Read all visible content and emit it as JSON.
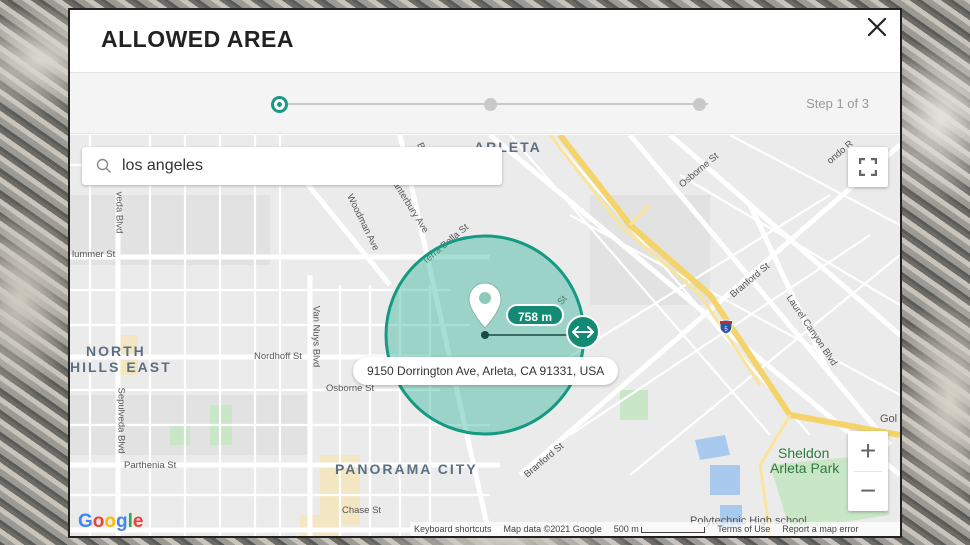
{
  "modal": {
    "title": "ALLOWED AREA",
    "close_icon": "close-icon"
  },
  "stepper": {
    "steps": 3,
    "current": 1,
    "label": "Step 1 of 3"
  },
  "search": {
    "value": "los angeles",
    "icon": "search-icon"
  },
  "map": {
    "area_labels": [
      "ARLETA",
      "NORTH",
      "HILLS EAST",
      "PANORAMA CITY",
      "Sheldon",
      "Arleta Park"
    ],
    "streets": [
      "Osborne St",
      "Woodman Ave",
      "Terra Bella St",
      "Van Nuys Blvd",
      "Nordhoff St",
      "Osborne St",
      "Parthenia St",
      "Branford St",
      "Laurel Canyon Blvd",
      "Branford St",
      "Chase St",
      "Sepulveda Blvd",
      "lummer St",
      "veda Blvd",
      "Canterbury Ave",
      "Be",
      "ondo R",
      "Gol",
      "Polytechnic High school",
      "St"
    ],
    "highway_shield": "5",
    "radius_label": "758 m",
    "address": "9150 Dorrington Ave, Arleta, CA 91331, USA",
    "google_logo": "Google",
    "attribution": {
      "shortcuts": "Keyboard shortcuts",
      "data": "Map data ©2021 Google",
      "scale": "500 m",
      "terms": "Terms of Use",
      "report": "Report a map error"
    },
    "controls": {
      "fullscreen_icon": "fullscreen-icon",
      "zoom_in": "+",
      "zoom_out": "−"
    },
    "accent_color": "#138a73"
  }
}
